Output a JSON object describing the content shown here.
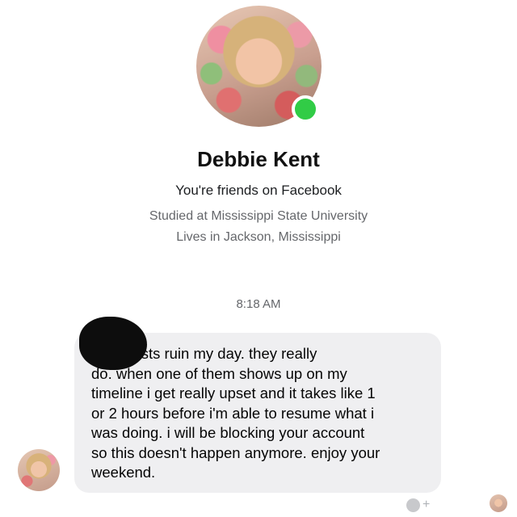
{
  "profile": {
    "name": "Debbie Kent",
    "friend_status": "You're friends on Facebook",
    "education": "Studied at Mississippi State University",
    "location": "Lives in Jackson, Mississippi",
    "online_color": "#31cc46"
  },
  "conversation": {
    "timestamp": "8:18 AM",
    "message": "your posts ruin my day. they really\ndo. when one of them shows up on my\ntimeline i get really upset and it takes like 1\nor 2 hours before i'm able to resume what i\nwas doing. i will be blocking your account\nso this doesn't happen anymore. enjoy your\nweekend.",
    "bubble_color": "#efeff1"
  },
  "icons": {
    "reaction": "add-reaction-icon",
    "read_receipt": "read-receipt-avatar"
  }
}
